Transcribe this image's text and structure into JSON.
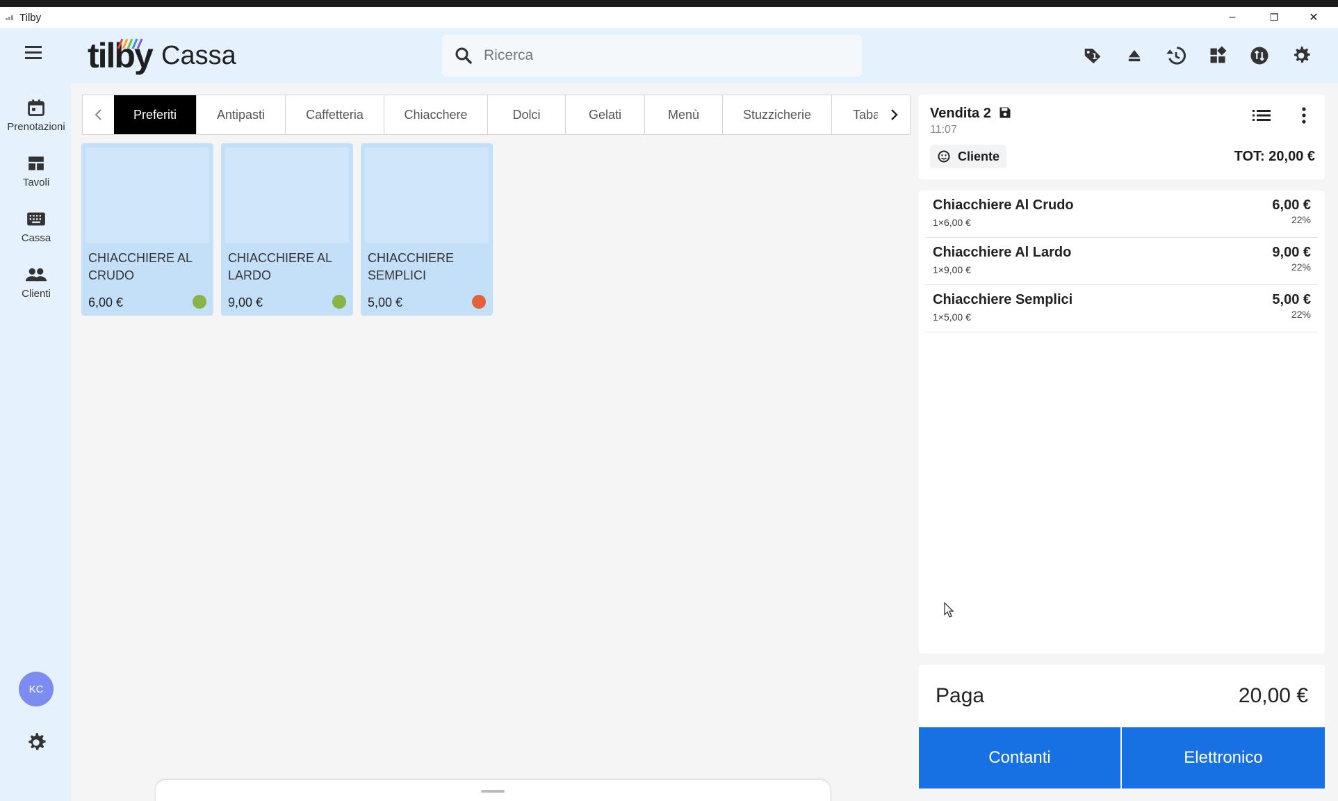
{
  "window": {
    "title": "Tilby",
    "minimize": "–",
    "maximize": "❐",
    "close": "✕"
  },
  "header": {
    "brand": "tilby",
    "page_title": "Cassa",
    "search_placeholder": "Ricerca",
    "icons": [
      "tag-icon",
      "eject-icon",
      "history-icon",
      "apps-icon",
      "transfer-icon",
      "settings-icon"
    ]
  },
  "rail": {
    "items": [
      {
        "label": "Prenotazioni",
        "icon": "calendar-icon"
      },
      {
        "label": "Tavoli",
        "icon": "dashboard-icon"
      },
      {
        "label": "Cassa",
        "icon": "keyboard-icon"
      },
      {
        "label": "Clienti",
        "icon": "people-icon"
      }
    ],
    "avatar_initials": "KC"
  },
  "categories": {
    "tabs": [
      {
        "label": "Preferiti",
        "active": true
      },
      {
        "label": "Antipasti"
      },
      {
        "label": "Caffetteria"
      },
      {
        "label": "Chiacchere"
      },
      {
        "label": "Dolci"
      },
      {
        "label": "Gelati"
      },
      {
        "label": "Menù"
      },
      {
        "label": "Stuzzicherie"
      },
      {
        "label": "Taba"
      }
    ]
  },
  "products": [
    {
      "name": "CHIACCHIERE AL CRUDO",
      "price": "6,00 €",
      "status_color": "#8ab34a"
    },
    {
      "name": "CHIACCHIERE AL LARDO",
      "price": "9,00 €",
      "status_color": "#8ab34a"
    },
    {
      "name": "CHIACCHIERE SEMPLICI",
      "price": "5,00 €",
      "status_color": "#e2603a"
    }
  ],
  "order": {
    "title": "Vendita 2",
    "time": "11:07",
    "customer_label": "Cliente",
    "total_label": "TOT: 20,00 €",
    "lines": [
      {
        "name": "Chiacchiere Al Crudo",
        "qty": "1×6,00 €",
        "total": "6,00 €",
        "vat": "22%"
      },
      {
        "name": "Chiacchiere Al Lardo",
        "qty": "1×9,00 €",
        "total": "9,00 €",
        "vat": "22%"
      },
      {
        "name": "Chiacchiere Semplici",
        "qty": "1×5,00 €",
        "total": "5,00 €",
        "vat": "22%"
      }
    ]
  },
  "payment": {
    "label": "Paga",
    "amount": "20,00 €",
    "cash_button": "Contanti",
    "electronic_button": "Elettronico"
  },
  "colors": {
    "accent": "#1871e3",
    "header_bg": "#e5f1fc",
    "tile_bg": "#c4e0f8",
    "active_tab": "#000000"
  }
}
